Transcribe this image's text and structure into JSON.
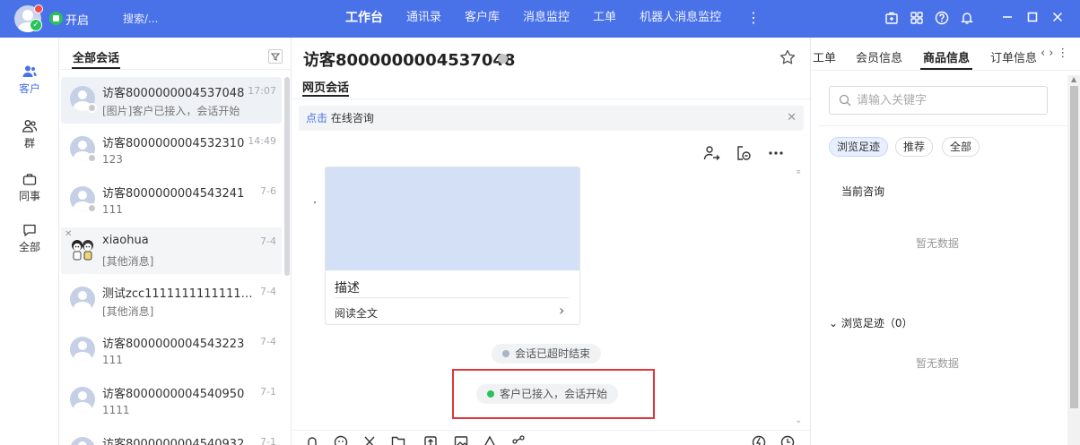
{
  "topbar": {
    "status_label": "开启",
    "search_placeholder": "搜索/...",
    "nav": [
      "工作台",
      "通讯录",
      "客户库",
      "消息监控",
      "工单",
      "机器人消息监控"
    ],
    "active_nav": "工作台",
    "more": "⋮",
    "accent_color": "#4a72e8"
  },
  "rail": {
    "items": [
      {
        "label": "客户",
        "icon": "customer-icon"
      },
      {
        "label": "群",
        "icon": "group-icon"
      },
      {
        "label": "同事",
        "icon": "briefcase-icon"
      },
      {
        "label": "全部",
        "icon": "chat-bubble-icon"
      }
    ]
  },
  "conversations": {
    "tab": "全部会话",
    "items": [
      {
        "name": "访客8000000004537048",
        "time": "17:07",
        "message": "[图片]客户已接入，会话开始"
      },
      {
        "name": "访客8000000004532310",
        "time": "14:49",
        "message": "123"
      },
      {
        "name": "访客8000000004543241",
        "time": "7-6",
        "message": "111"
      },
      {
        "name": "xiaohua",
        "time": "7-4",
        "message": "[其他消息]"
      },
      {
        "name": "测试zcc111111111111111...",
        "time": "7-4",
        "message": "[其他消息]"
      },
      {
        "name": "访客8000000004543223",
        "time": "7-4",
        "message": "111"
      },
      {
        "name": "访客8000000004540950",
        "time": "7-1",
        "message": "1111"
      },
      {
        "name": "访客8000000004540932",
        "time": "7-1",
        "message": ""
      }
    ]
  },
  "chat": {
    "title": "访客8000000004537048",
    "tab": "网页会话",
    "notice_accent": "点击",
    "notice_text": "在线咨询",
    "card": {
      "title": "描述",
      "link": "阅读全文"
    },
    "system_messages": [
      {
        "text": "会话已超时结束",
        "dot_color": "#a9b4c8"
      },
      {
        "text": "客户已接入，会话开始",
        "dot_color": "#29c25a"
      }
    ]
  },
  "right_panel": {
    "tabs": [
      "工单",
      "会员信息",
      "商品信息",
      "订单信息"
    ],
    "active_tab": "商品信息",
    "search_placeholder": "请输入关键字",
    "chips": [
      "浏览足迹",
      "推荐",
      "全部"
    ],
    "active_chip": "浏览足迹",
    "current_label": "当前咨询",
    "empty_text": "暂无数据",
    "history_label": "浏览足迹（0）",
    "history_empty": "暂无数据"
  }
}
